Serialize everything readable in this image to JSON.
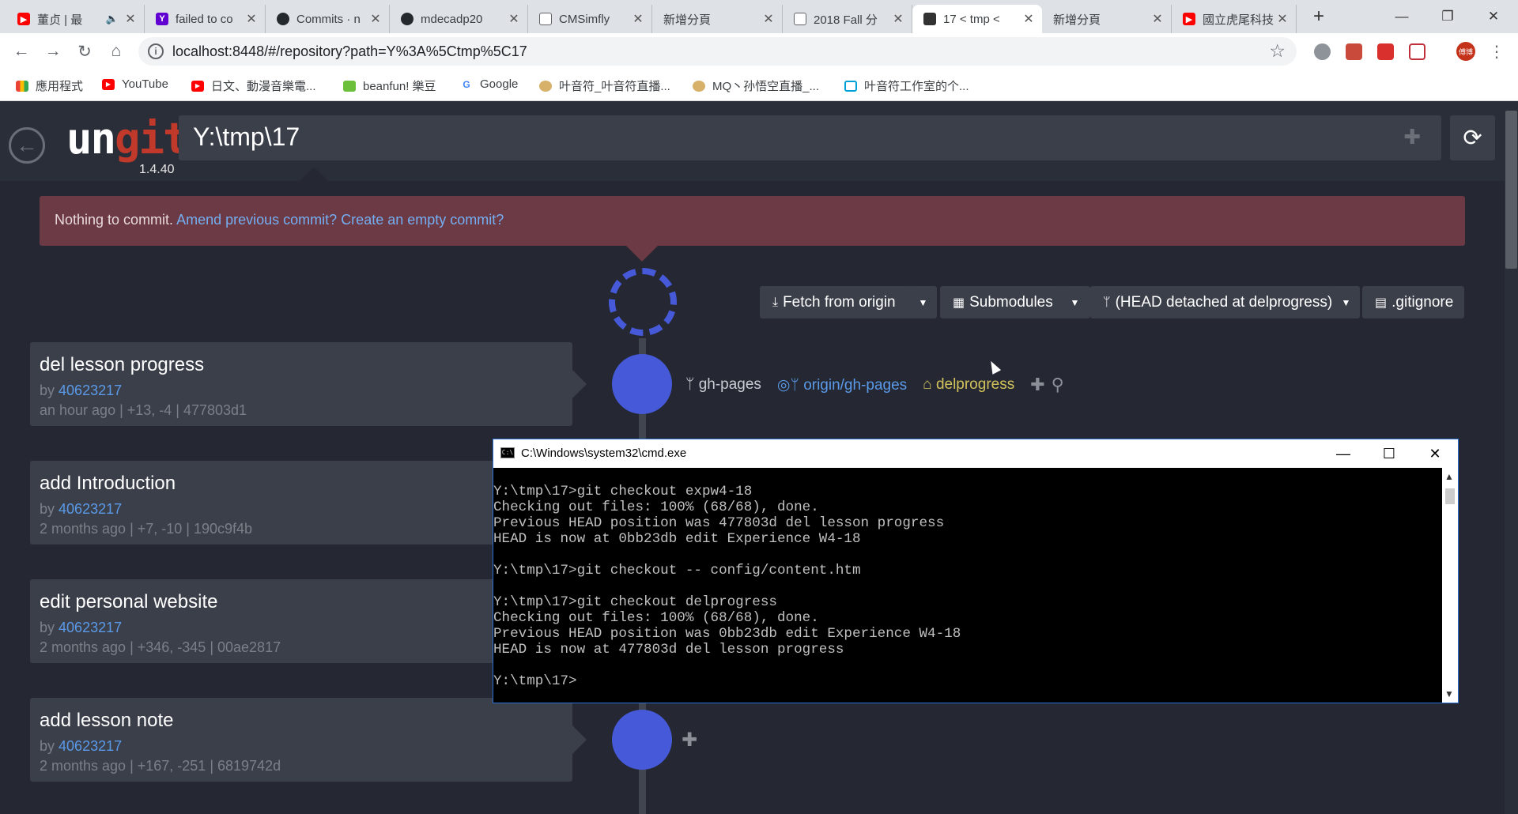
{
  "browser": {
    "tabs": [
      {
        "title": "董贞 | 最",
        "icon": "youtube-icon",
        "color": "#ff0000"
      },
      {
        "title": "failed to co",
        "icon": "yahoo-icon",
        "color": "#6001d2"
      },
      {
        "title": "Commits · n",
        "icon": "github-icon",
        "color": "#24292e"
      },
      {
        "title": "mdecadp20",
        "icon": "github-icon",
        "color": "#24292e"
      },
      {
        "title": "CMSimfly",
        "icon": "page-icon",
        "color": "#5f6368"
      },
      {
        "title": "新增分頁",
        "icon": "",
        "color": ""
      },
      {
        "title": "2018 Fall 分",
        "icon": "page-icon",
        "color": "#5f6368"
      },
      {
        "title": "17 < tmp <",
        "icon": "ungit-icon",
        "color": "#333"
      },
      {
        "title": "新增分頁",
        "icon": "",
        "color": ""
      },
      {
        "title": "國立虎尾科技",
        "icon": "youtube-icon",
        "color": "#ff0000"
      }
    ],
    "url": "localhost:8448/#/repository?path=Y%3A%5Ctmp%5C17",
    "bookmarks": [
      {
        "label": "應用程式",
        "icon": "apps-grid-icon"
      },
      {
        "label": "YouTube",
        "icon": "youtube-icon"
      },
      {
        "label": "日文、動漫音樂電...",
        "icon": "youtube-icon"
      },
      {
        "label": "beanfun! 樂豆",
        "icon": "beanfun-icon"
      },
      {
        "label": "Google",
        "icon": "google-icon"
      },
      {
        "label": "叶音符_叶音符直播...",
        "icon": "bird-icon"
      },
      {
        "label": "MQ丶孙悟空直播_...",
        "icon": "bird-icon"
      },
      {
        "label": "叶音符工作室的个...",
        "icon": "bilibili-icon"
      }
    ],
    "profile_label": "傅博"
  },
  "ungit": {
    "logo_un": "un",
    "logo_git": "git",
    "version": "1.4.40",
    "path": "Y:\\tmp\\17",
    "alert_text": "Nothing to commit.",
    "alert_link_amend": "Amend previous commit?",
    "alert_link_empty": "Create an empty commit?",
    "toolbar": {
      "fetch": "Fetch from origin",
      "submodules": "Submodules",
      "head": "(HEAD detached at delprogress)",
      "gitignore": ".gitignore"
    },
    "refs": {
      "local_branch": "gh-pages",
      "remote_branch": "origin/gh-pages",
      "tag": "delprogress"
    },
    "commits": [
      {
        "title": "del lesson progress",
        "by": "by",
        "author": "40623217",
        "meta": "an hour ago | +13, -4 | 477803d1"
      },
      {
        "title": "add Introduction",
        "by": "by",
        "author": "40623217",
        "meta": "2 months ago | +7, -10 | 190c9f4b"
      },
      {
        "title": "edit personal website",
        "by": "by",
        "author": "40623217",
        "meta": "2 months ago | +346, -345 | 00ae2817"
      },
      {
        "title": "add lesson note",
        "by": "by",
        "author": "40623217",
        "meta": "2 months ago | +167, -251 | 6819742d"
      }
    ]
  },
  "cmd": {
    "title": "C:\\Windows\\system32\\cmd.exe",
    "output": "Y:\\tmp\\17>git checkout expw4-18\nChecking out files: 100% (68/68), done.\nPrevious HEAD position was 477803d del lesson progress\nHEAD is now at 0bb23db edit Experience W4-18\n\nY:\\tmp\\17>git checkout -- config/content.htm\n\nY:\\tmp\\17>git checkout delprogress\nChecking out files: 100% (68/68), done.\nPrevious HEAD position was 0bb23db edit Experience W4-18\nHEAD is now at 477803d del lesson progress\n\nY:\\tmp\\17>"
  },
  "colors": {
    "node": "#4659d9",
    "alert_bg": "#6c3a45",
    "link": "#5a9ae8",
    "tag": "#d2c25c"
  }
}
